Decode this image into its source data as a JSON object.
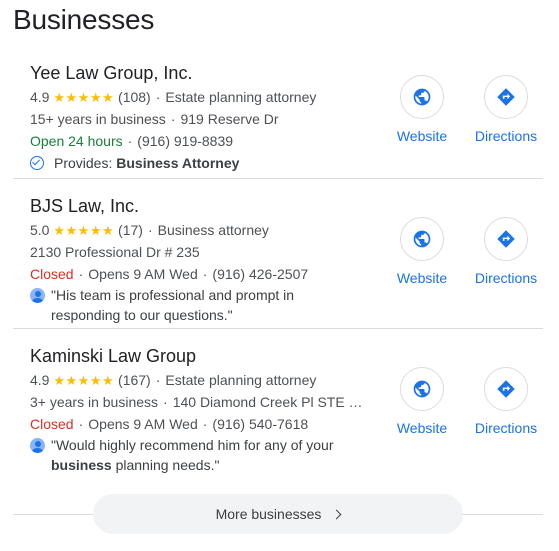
{
  "section_title": "Businesses",
  "listings": [
    {
      "name": "Yee Law Group, Inc.",
      "rating": "4.9",
      "stars": "★★★★★",
      "reviews": "(108)",
      "category": "Estate planning attorney",
      "line2": "15+ years in business",
      "address": "919 Reserve Dr",
      "status": "Open 24 hours",
      "phone": "(916) 919-8839",
      "provides_label": "Provides:",
      "provides_value": "Business Attorney"
    },
    {
      "name": "BJS Law, Inc.",
      "rating": "5.0",
      "stars": "★★★★★",
      "reviews": "(17)",
      "category": "Business attorney",
      "address": "2130 Professional Dr # 235",
      "status": "Closed",
      "hours": "Opens 9 AM Wed",
      "phone": "(916) 426-2507",
      "review_line1": "\"His team is professional and prompt in",
      "review_line2": "responding to our questions.\""
    },
    {
      "name": "Kaminski Law Group",
      "rating": "4.9",
      "stars": "★★★★★",
      "reviews": "(167)",
      "category": "Estate planning attorney",
      "line2": "3+ years in business",
      "address": "140 Diamond Creek Pl STE …",
      "status": "Closed",
      "hours": "Opens 9 AM Wed",
      "phone": "(916) 540-7618",
      "review_line1": "\"Would highly recommend him for any of your",
      "review_bold": "business",
      "review_rest": " planning needs.\""
    }
  ],
  "actions": {
    "website_label": "Website",
    "directions_label": "Directions"
  },
  "more_button_label": "More businesses",
  "colors": {
    "accent": "#1a73e8",
    "open": "#188038",
    "closed": "#d93025",
    "star": "#fbbc04"
  }
}
